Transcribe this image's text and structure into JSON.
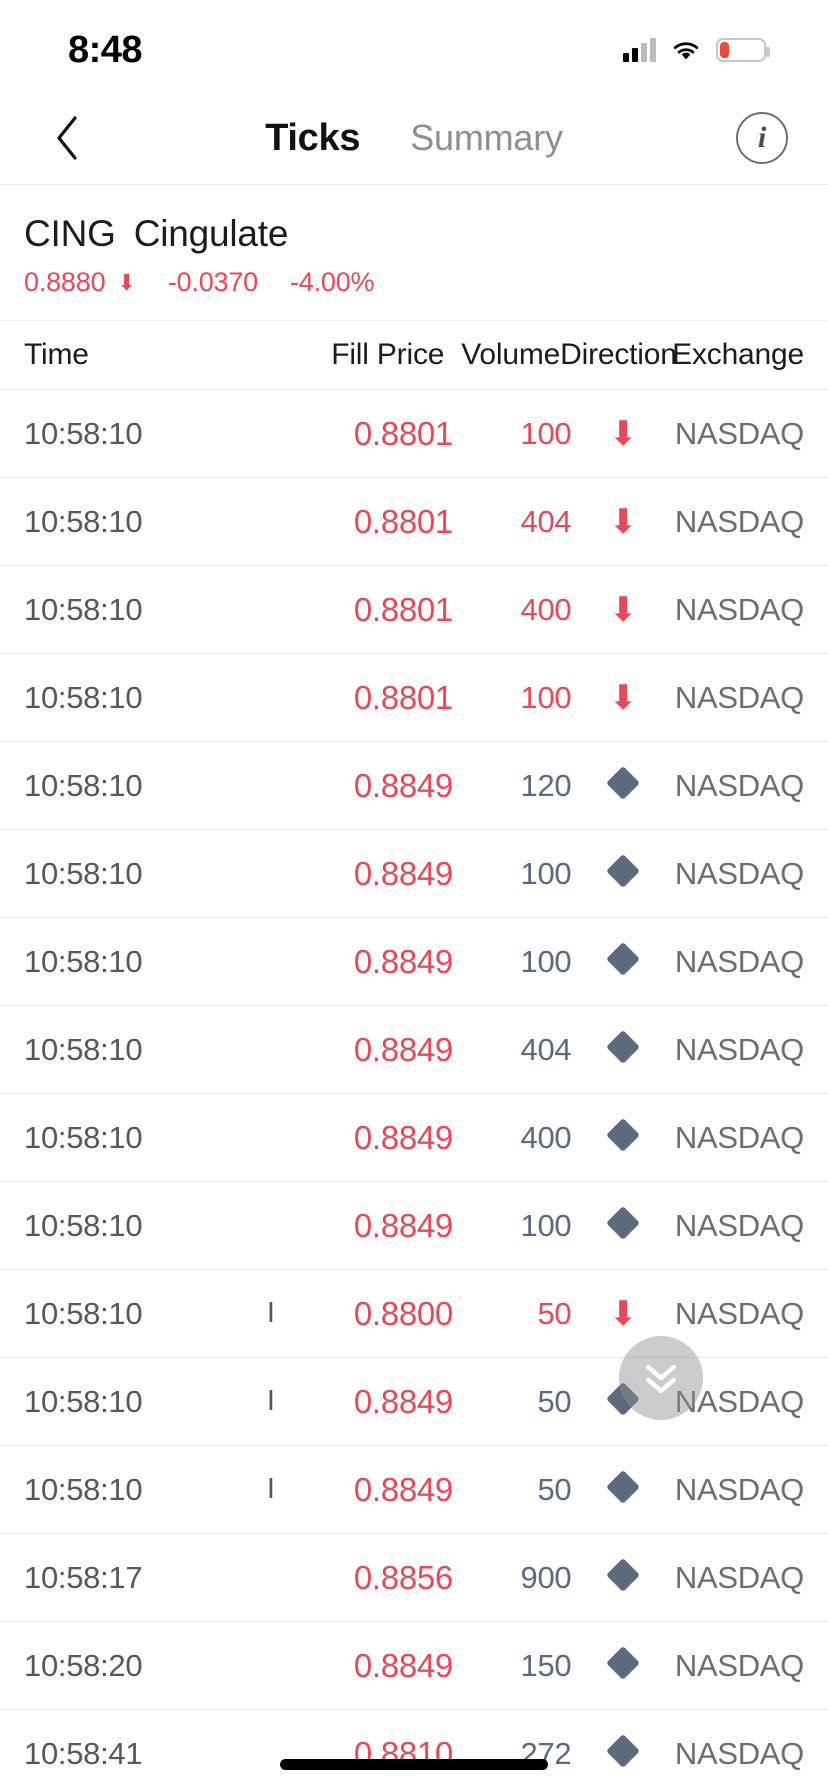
{
  "status_bar": {
    "time": "8:48",
    "signal_icon": "cellular-signal-icon",
    "wifi_icon": "wifi-icon",
    "battery_icon": "battery-low-icon",
    "battery_color": "#f04a3f"
  },
  "navbar": {
    "back_icon": "chevron-left-icon",
    "tabs": [
      {
        "label": "Ticks",
        "active": true
      },
      {
        "label": "Summary",
        "active": false
      }
    ],
    "info_label": "i",
    "info_icon": "info-circle-icon"
  },
  "quote": {
    "symbol": "CING",
    "company": "Cingulate",
    "last_price": "0.8880",
    "arrow": "⬇",
    "change": "-0.0370",
    "change_pct": "-4.00%",
    "down_color": "#e8495a"
  },
  "table": {
    "columns": {
      "time": "Time",
      "fill_price": "Fill Price",
      "volume": "Volume",
      "direction": "Direction",
      "exchange": "Exchange"
    },
    "rows": [
      {
        "time": "10:58:10",
        "mark": "",
        "price": "0.8801",
        "volume": "100",
        "direction": "down",
        "exchange": "NASDAQ"
      },
      {
        "time": "10:58:10",
        "mark": "",
        "price": "0.8801",
        "volume": "404",
        "direction": "down",
        "exchange": "NASDAQ"
      },
      {
        "time": "10:58:10",
        "mark": "",
        "price": "0.8801",
        "volume": "400",
        "direction": "down",
        "exchange": "NASDAQ"
      },
      {
        "time": "10:58:10",
        "mark": "",
        "price": "0.8801",
        "volume": "100",
        "direction": "down",
        "exchange": "NASDAQ"
      },
      {
        "time": "10:58:10",
        "mark": "",
        "price": "0.8849",
        "volume": "120",
        "direction": "flat",
        "exchange": "NASDAQ"
      },
      {
        "time": "10:58:10",
        "mark": "",
        "price": "0.8849",
        "volume": "100",
        "direction": "flat",
        "exchange": "NASDAQ"
      },
      {
        "time": "10:58:10",
        "mark": "",
        "price": "0.8849",
        "volume": "100",
        "direction": "flat",
        "exchange": "NASDAQ"
      },
      {
        "time": "10:58:10",
        "mark": "",
        "price": "0.8849",
        "volume": "404",
        "direction": "flat",
        "exchange": "NASDAQ"
      },
      {
        "time": "10:58:10",
        "mark": "",
        "price": "0.8849",
        "volume": "400",
        "direction": "flat",
        "exchange": "NASDAQ"
      },
      {
        "time": "10:58:10",
        "mark": "",
        "price": "0.8849",
        "volume": "100",
        "direction": "flat",
        "exchange": "NASDAQ"
      },
      {
        "time": "10:58:10",
        "mark": "I",
        "price": "0.8800",
        "volume": "50",
        "direction": "down",
        "exchange": "NASDAQ"
      },
      {
        "time": "10:58:10",
        "mark": "I",
        "price": "0.8849",
        "volume": "50",
        "direction": "flat",
        "exchange": "NASDAQ"
      },
      {
        "time": "10:58:10",
        "mark": "I",
        "price": "0.8849",
        "volume": "50",
        "direction": "flat",
        "exchange": "NASDAQ"
      },
      {
        "time": "10:58:17",
        "mark": "",
        "price": "0.8856",
        "volume": "900",
        "direction": "flat",
        "exchange": "NASDAQ"
      },
      {
        "time": "10:58:20",
        "mark": "",
        "price": "0.8849",
        "volume": "150",
        "direction": "flat",
        "exchange": "NASDAQ"
      },
      {
        "time": "10:58:41",
        "mark": "",
        "price": "0.8810",
        "volume": "272",
        "direction": "flat",
        "exchange": "NASDAQ"
      }
    ]
  },
  "scroll_button": {
    "icon": "chevron-double-down-icon"
  },
  "colors": {
    "down": "#e8495a",
    "neutral_diamond": "#5c6a80",
    "muted_text": "#6d6d72"
  }
}
